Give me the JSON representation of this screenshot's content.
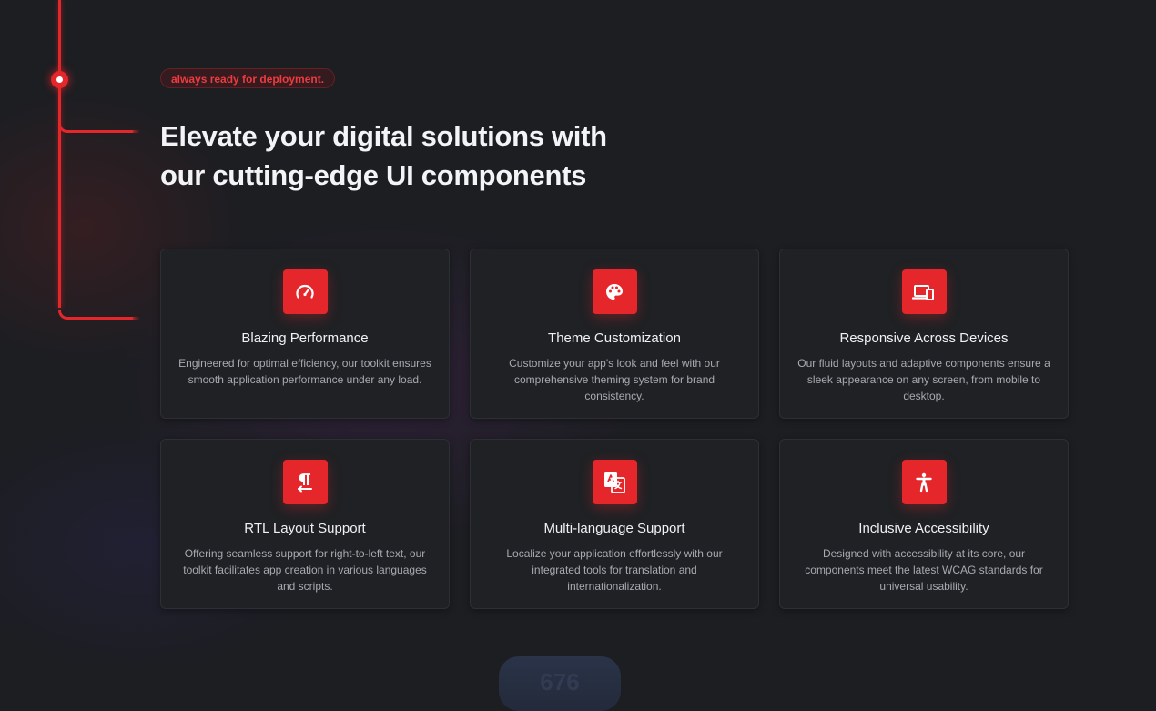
{
  "header": {
    "badge": "always ready for deployment.",
    "title_line1": "Elevate your digital solutions with",
    "title_line2": "our cutting-edge UI components"
  },
  "features": [
    {
      "icon": "speedometer-icon",
      "title": "Blazing Performance",
      "description": "Engineered for optimal efficiency, our toolkit ensures smooth application performance under any load."
    },
    {
      "icon": "palette-icon",
      "title": "Theme Customization",
      "description": "Customize your app's look and feel with our comprehensive theming system for brand consistency."
    },
    {
      "icon": "devices-icon",
      "title": "Responsive Across Devices",
      "description": "Our fluid layouts and adaptive components ensure a sleek appearance on any screen, from mobile to desktop."
    },
    {
      "icon": "text-direction-rtl-icon",
      "title": "RTL Layout Support",
      "description": "Offering seamless support for right-to-left text, our toolkit facilitates app creation in various languages and scripts."
    },
    {
      "icon": "translate-icon",
      "title": "Multi-language Support",
      "description": "Localize your application effortlessly with our integrated tools for translation and internationalization."
    },
    {
      "icon": "accessibility-icon",
      "title": "Inclusive Accessibility",
      "description": "Designed with accessibility at its core, our components meet the latest WCAG standards for universal usability."
    }
  ],
  "counter": {
    "value": "676"
  },
  "colors": {
    "accent": "#e5262a",
    "background": "#1c1e22",
    "card": "#1f2124"
  }
}
